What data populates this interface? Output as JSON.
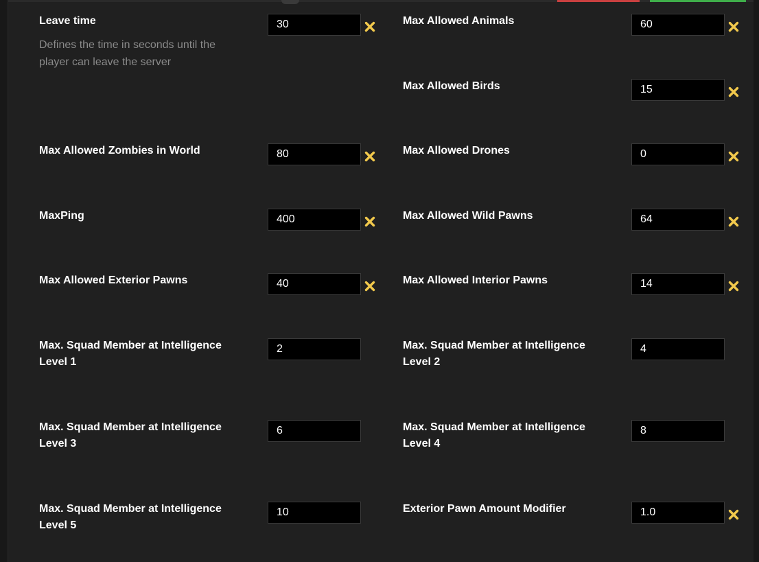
{
  "colors": {
    "background": "#202020",
    "label": "#ffffff",
    "description": "#8a8a8a",
    "input_bg": "#000000",
    "reset_icon": "#f2c94c",
    "top_red": "#c94040",
    "top_green": "#3fae4a"
  },
  "settings": {
    "leave_time": {
      "label": "Leave time",
      "description": "Defines the time in seconds until the player can leave the server",
      "value": "30",
      "reset_icon": "close-x-icon"
    },
    "max_allowed_animals": {
      "label": "Max Allowed Animals",
      "value": "60",
      "reset_icon": "close-x-icon"
    },
    "max_allowed_birds": {
      "label": "Max Allowed Birds",
      "value": "15",
      "reset_icon": "close-x-icon"
    },
    "max_allowed_zombies": {
      "label": "Max Allowed Zombies in World",
      "value": "80",
      "reset_icon": "close-x-icon"
    },
    "max_allowed_drones": {
      "label": "Max Allowed Drones",
      "value": "0",
      "reset_icon": "close-x-icon"
    },
    "max_ping": {
      "label": "MaxPing",
      "value": "400",
      "reset_icon": "close-x-icon"
    },
    "max_allowed_wild_pawns": {
      "label": "Max Allowed Wild Pawns",
      "value": "64",
      "reset_icon": "close-x-icon"
    },
    "max_allowed_exterior_pawns": {
      "label": "Max Allowed Exterior Pawns",
      "value": "40",
      "reset_icon": "close-x-icon"
    },
    "max_allowed_interior_pawns": {
      "label": "Max Allowed Interior Pawns",
      "value": "14",
      "reset_icon": "close-x-icon"
    },
    "squad_level_1": {
      "label": "Max. Squad Member at Intelligence Level 1",
      "value": "2"
    },
    "squad_level_2": {
      "label": "Max. Squad Member at Intelligence Level 2",
      "value": "4"
    },
    "squad_level_3": {
      "label": "Max. Squad Member at Intelligence Level 3",
      "value": "6"
    },
    "squad_level_4": {
      "label": "Max. Squad Member at Intelligence Level 4",
      "value": "8"
    },
    "squad_level_5": {
      "label": "Max. Squad Member at Intelligence Level 5",
      "value": "10"
    },
    "exterior_pawn_amount_modifier": {
      "label": "Exterior Pawn Amount Modifier",
      "value": "1.0",
      "reset_icon": "close-x-icon"
    }
  }
}
